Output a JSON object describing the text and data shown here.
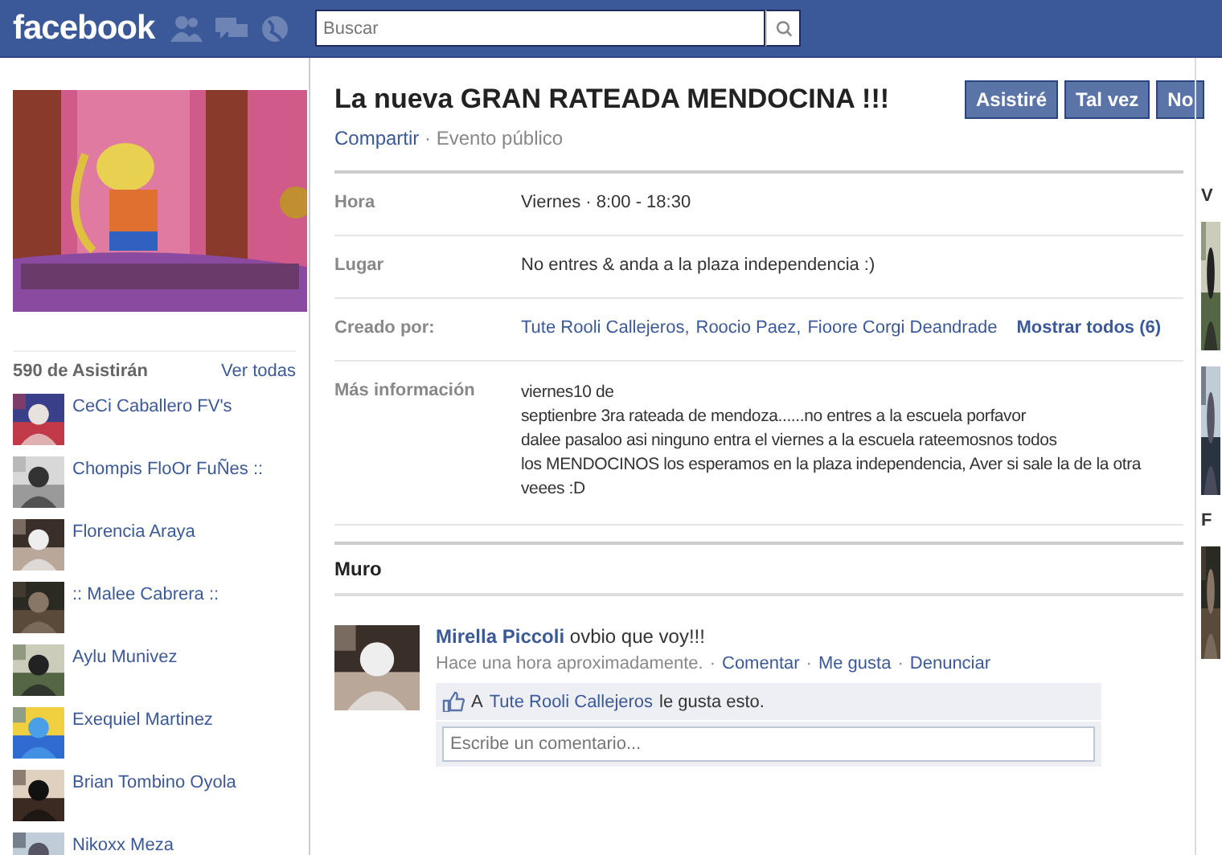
{
  "header": {
    "logo": "facebook",
    "search": {
      "placeholder": "Buscar"
    }
  },
  "sidebar": {
    "attendees_title": "590 de Asistirán",
    "see_all": "Ver todas",
    "attendees": [
      {
        "name": "CeCi Caballero FV's"
      },
      {
        "name": "Chompis FloOr FuÑes ::"
      },
      {
        "name": "Florencia Araya"
      },
      {
        "name": ":: Malee Cabrera ::"
      },
      {
        "name": "Aylu Munivez"
      },
      {
        "name": "Exequiel Martinez"
      },
      {
        "name": "Brian Tombino Oyola"
      },
      {
        "name": "Nikoxx Meza"
      }
    ]
  },
  "event": {
    "title": "La nueva GRAN RATEADA MENDOCINA !!!",
    "buttons": [
      "Asistiré",
      "Tal vez",
      "No"
    ],
    "share": "Compartir",
    "privacy": "· Evento público",
    "details": [
      {
        "label": "Hora",
        "value": "Viernes · 8:00 - 18:30"
      },
      {
        "label": "Lugar",
        "value": "No entres & anda a la plaza independencia :)"
      },
      {
        "label": "Creado por:",
        "creators": [
          "Tute Rooli Callejeros,",
          "Roocio Paez,",
          "Fioore Corgi Deandrade"
        ],
        "more": "Mostrar todos (6)"
      },
      {
        "label": "Más información",
        "lines": [
          "viernes10 de",
          "septienbre 3ra rateada de mendoza......no entres a la escuela porfavor",
          "dalee pasaloo asi ninguno entra el viernes a la escuela rateemosnos todos",
          "los MENDOCINOS los esperamos en la plaza independencia, Aver si sale la de la otra",
          "veees :D"
        ]
      }
    ]
  },
  "wall": {
    "title": "Muro",
    "post": {
      "author": "Mirella Piccoli",
      "text": "ovbio que voy!!!",
      "time": "Hace una hora aproximadamente.",
      "actions": [
        "Comentar",
        "Me gusta",
        "Denunciar"
      ],
      "separator": "·",
      "like_prefix": "A",
      "like_user": "Tute Rooli Callejeros",
      "like_suffix": "le gusta esto.",
      "comment_placeholder": "Escribe un comentario..."
    }
  },
  "right_column": {
    "letters": [
      "V",
      "F"
    ]
  }
}
